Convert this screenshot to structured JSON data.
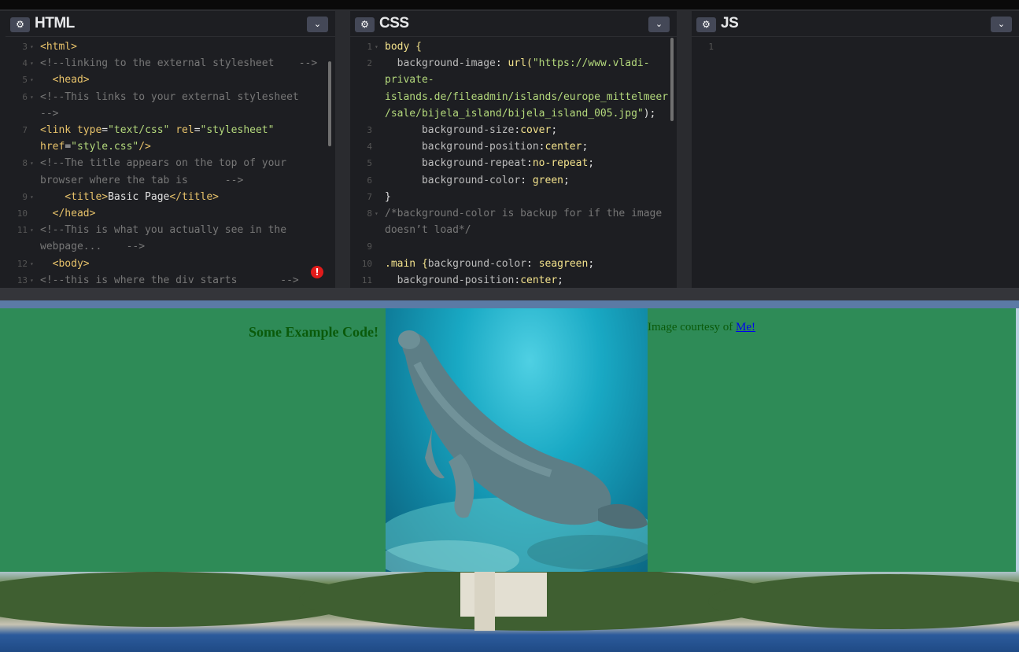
{
  "panels": {
    "html": {
      "title": "HTML",
      "lines": [
        {
          "num": "3",
          "fold": true,
          "parts": [
            {
              "t": "<html>",
              "c": "tag"
            }
          ]
        },
        {
          "num": "4",
          "fold": true,
          "parts": [
            {
              "t": "<!--linking to the external stylesheet    -->",
              "c": "com"
            }
          ]
        },
        {
          "num": "5",
          "fold": true,
          "parts": [
            {
              "t": "  <head>",
              "c": "tag"
            }
          ]
        },
        {
          "num": "6",
          "fold": true,
          "parts": [
            {
              "t": "<!--This links to your external stylesheet",
              "c": "com"
            }
          ]
        },
        {
          "num": "",
          "fold": false,
          "parts": [
            {
              "t": "-->",
              "c": "com"
            }
          ]
        },
        {
          "num": "7",
          "fold": false,
          "parts": [
            {
              "t": "<link ",
              "c": "tag"
            },
            {
              "t": "type",
              "c": "attr"
            },
            {
              "t": "=",
              "c": "pl"
            },
            {
              "t": "\"text/css\"",
              "c": "str"
            },
            {
              "t": " rel",
              "c": "attr"
            },
            {
              "t": "=",
              "c": "pl"
            },
            {
              "t": "\"stylesheet\"",
              "c": "str"
            }
          ]
        },
        {
          "num": "",
          "fold": false,
          "parts": [
            {
              "t": "href",
              "c": "attr"
            },
            {
              "t": "=",
              "c": "pl"
            },
            {
              "t": "\"style.css\"",
              "c": "str"
            },
            {
              "t": "/>",
              "c": "tag"
            }
          ]
        },
        {
          "num": "8",
          "fold": true,
          "parts": [
            {
              "t": "<!--The title appears on the top of your",
              "c": "com"
            }
          ]
        },
        {
          "num": "",
          "fold": false,
          "parts": [
            {
              "t": "browser where the tab is      -->",
              "c": "com"
            }
          ]
        },
        {
          "num": "9",
          "fold": true,
          "parts": [
            {
              "t": "    <title>",
              "c": "tag"
            },
            {
              "t": "Basic Page",
              "c": "pl"
            },
            {
              "t": "</title>",
              "c": "tag"
            }
          ]
        },
        {
          "num": "10",
          "fold": false,
          "parts": [
            {
              "t": "  </head>",
              "c": "tag"
            }
          ]
        },
        {
          "num": "11",
          "fold": true,
          "parts": [
            {
              "t": "<!--This is what you actually see in the",
              "c": "com"
            }
          ]
        },
        {
          "num": "",
          "fold": false,
          "parts": [
            {
              "t": "webpage...    -->",
              "c": "com"
            }
          ]
        },
        {
          "num": "12",
          "fold": true,
          "parts": [
            {
              "t": "  <body>",
              "c": "tag"
            }
          ]
        },
        {
          "num": "13",
          "fold": true,
          "parts": [
            {
              "t": "<!--this is where the div starts       -->",
              "c": "com"
            }
          ]
        }
      ]
    },
    "css": {
      "title": "CSS",
      "lines": [
        {
          "num": "1",
          "fold": true,
          "parts": [
            {
              "t": "body {",
              "c": "sel"
            }
          ]
        },
        {
          "num": "2",
          "fold": false,
          "parts": [
            {
              "t": "  background-image",
              "c": "prop"
            },
            {
              "t": ": ",
              "c": "pl"
            },
            {
              "t": "url(",
              "c": "val"
            },
            {
              "t": "\"https://www.vladi-",
              "c": "str"
            }
          ]
        },
        {
          "num": "",
          "fold": false,
          "parts": [
            {
              "t": "private-",
              "c": "str"
            }
          ]
        },
        {
          "num": "",
          "fold": false,
          "parts": [
            {
              "t": "islands.de/fileadmin/islands/europe_mittelmeer",
              "c": "str"
            }
          ]
        },
        {
          "num": "",
          "fold": false,
          "parts": [
            {
              "t": "/sale/bijela_island/bijela_island_005.jpg\"",
              "c": "str"
            },
            {
              "t": ");",
              "c": "pl"
            }
          ]
        },
        {
          "num": "3",
          "fold": false,
          "parts": [
            {
              "t": "      background-size",
              "c": "prop"
            },
            {
              "t": ":",
              "c": "pl"
            },
            {
              "t": "cover",
              "c": "val"
            },
            {
              "t": ";",
              "c": "pl"
            }
          ]
        },
        {
          "num": "4",
          "fold": false,
          "parts": [
            {
              "t": "      background-position",
              "c": "prop"
            },
            {
              "t": ":",
              "c": "pl"
            },
            {
              "t": "center",
              "c": "val"
            },
            {
              "t": ";",
              "c": "pl"
            }
          ]
        },
        {
          "num": "5",
          "fold": false,
          "parts": [
            {
              "t": "      background-repeat",
              "c": "prop"
            },
            {
              "t": ":",
              "c": "pl"
            },
            {
              "t": "no-repeat",
              "c": "val"
            },
            {
              "t": ";",
              "c": "pl"
            }
          ]
        },
        {
          "num": "6",
          "fold": false,
          "parts": [
            {
              "t": "      background-color",
              "c": "prop"
            },
            {
              "t": ": ",
              "c": "pl"
            },
            {
              "t": "green",
              "c": "val"
            },
            {
              "t": ";",
              "c": "pl"
            }
          ]
        },
        {
          "num": "7",
          "fold": false,
          "parts": [
            {
              "t": "}",
              "c": "pl"
            }
          ]
        },
        {
          "num": "8",
          "fold": true,
          "parts": [
            {
              "t": "/*background-color is backup for if the image",
              "c": "com"
            }
          ]
        },
        {
          "num": "",
          "fold": false,
          "parts": [
            {
              "t": "doesn’t load*/",
              "c": "com"
            }
          ]
        },
        {
          "num": "9",
          "fold": false,
          "parts": []
        },
        {
          "num": "10",
          "fold": false,
          "parts": [
            {
              "t": ".main {",
              "c": "sel"
            },
            {
              "t": "background-color",
              "c": "prop"
            },
            {
              "t": ": ",
              "c": "pl"
            },
            {
              "t": "seagreen",
              "c": "val"
            },
            {
              "t": ";",
              "c": "pl"
            }
          ]
        },
        {
          "num": "11",
          "fold": false,
          "parts": [
            {
              "t": "  background-position",
              "c": "prop"
            },
            {
              "t": ":",
              "c": "pl"
            },
            {
              "t": "center",
              "c": "val"
            },
            {
              "t": ";",
              "c": "pl"
            }
          ]
        }
      ]
    },
    "js": {
      "title": "JS",
      "lines": [
        {
          "num": "1",
          "fold": false,
          "parts": []
        }
      ]
    }
  },
  "icons": {
    "gear": "⚙",
    "chevron": "⌄",
    "error": "!"
  },
  "preview": {
    "heading": "Some Example Code!",
    "credit_text": "Image courtesy of ",
    "credit_link": "Me!"
  },
  "colors": {
    "main_bg": "#2e8b57",
    "editor_bg": "#1d1e22"
  }
}
